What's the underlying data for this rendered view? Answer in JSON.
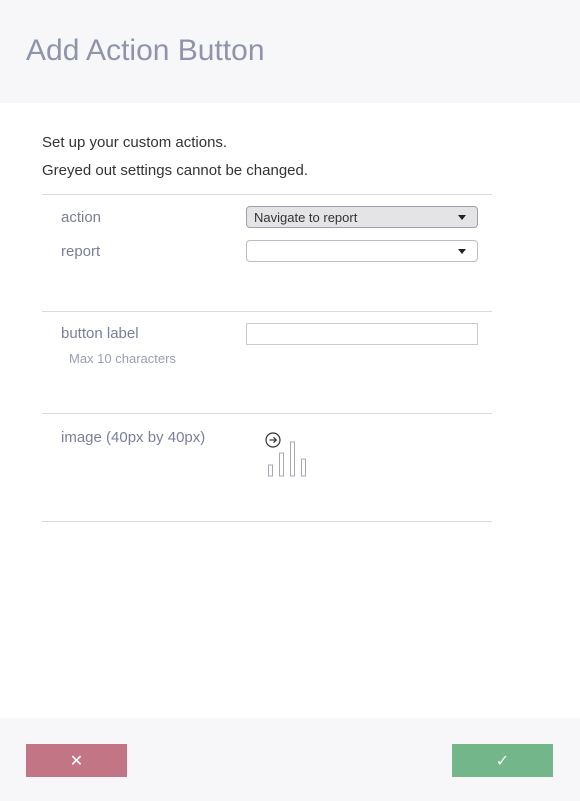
{
  "dialog": {
    "title": "Add Action Button",
    "intro_line1": "Set up your custom actions.",
    "intro_line2": "Greyed out settings cannot be changed."
  },
  "fields": {
    "action": {
      "label": "action",
      "value": "Navigate to report",
      "disabled": true
    },
    "report": {
      "label": "report",
      "value": ""
    },
    "button_label": {
      "label": "button label",
      "hint": "Max 10 characters",
      "value": ""
    },
    "image": {
      "label": "image (40px by 40px)",
      "icon": "navigate-to-report-icon"
    }
  },
  "footer": {
    "cancel_symbol": "✕",
    "confirm_symbol": "✓"
  },
  "colors": {
    "title": "#8f94ab",
    "label": "#7a7f9a",
    "cancel": "#c27585",
    "confirm": "#72b68a",
    "panel_bg": "#f7f7f9"
  }
}
